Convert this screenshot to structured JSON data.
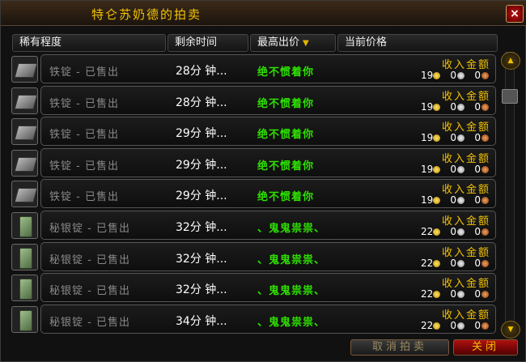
{
  "window": {
    "title": "特仑苏奶德的拍卖",
    "close_icon": "×"
  },
  "columns": [
    {
      "label": "稀有程度"
    },
    {
      "label": "剩余时间"
    },
    {
      "label": "最高出价",
      "sort_icon": "▼"
    },
    {
      "label": "当前价格"
    }
  ],
  "rows": [
    {
      "icon": "iron-ingot-icon",
      "name": "铁锭 - 已售出",
      "time": "28分 钟...",
      "bidder": "绝不惯着你",
      "income_label": "收入金额",
      "gold": "19",
      "silver": "0",
      "copper": "0"
    },
    {
      "icon": "iron-ingot-icon",
      "name": "铁锭 - 已售出",
      "time": "28分 钟...",
      "bidder": "绝不惯着你",
      "income_label": "收入金额",
      "gold": "19",
      "silver": "0",
      "copper": "0"
    },
    {
      "icon": "iron-ingot-icon",
      "name": "铁锭 - 已售出",
      "time": "29分 钟...",
      "bidder": "绝不惯着你",
      "income_label": "收入金额",
      "gold": "19",
      "silver": "0",
      "copper": "0"
    },
    {
      "icon": "iron-ingot-icon",
      "name": "铁锭 - 已售出",
      "time": "29分 钟...",
      "bidder": "绝不惯着你",
      "income_label": "收入金额",
      "gold": "19",
      "silver": "0",
      "copper": "0"
    },
    {
      "icon": "iron-ingot-icon",
      "name": "铁锭 - 已售出",
      "time": "29分 钟...",
      "bidder": "绝不惯着你",
      "income_label": "收入金额",
      "gold": "19",
      "silver": "0",
      "copper": "0"
    },
    {
      "icon": "mithril-ingot-icon",
      "name": "秘银锭 - 已售出",
      "time": "32分 钟...",
      "bidder": "、鬼鬼祟祟、",
      "income_label": "收入金额",
      "gold": "22",
      "silver": "0",
      "copper": "0"
    },
    {
      "icon": "mithril-ingot-icon",
      "name": "秘银锭 - 已售出",
      "time": "32分 钟...",
      "bidder": "、鬼鬼祟祟、",
      "income_label": "收入金额",
      "gold": "22",
      "silver": "0",
      "copper": "0"
    },
    {
      "icon": "mithril-ingot-icon",
      "name": "秘银锭 - 已售出",
      "time": "32分 钟...",
      "bidder": "、鬼鬼祟祟、",
      "income_label": "收入金额",
      "gold": "22",
      "silver": "0",
      "copper": "0"
    },
    {
      "icon": "mithril-ingot-icon",
      "name": "秘银锭 - 已售出",
      "time": "34分 钟...",
      "bidder": "、鬼鬼祟祟、",
      "income_label": "收入金额",
      "gold": "22",
      "silver": "0",
      "copper": "0"
    }
  ],
  "scrollbar": {
    "up_icon": "▲",
    "down_icon": "▼"
  },
  "buttons": {
    "cancel_auction": "取消拍卖",
    "close": "关闭"
  },
  "colors": {
    "title": "#f2c200",
    "bidder": "#2ee000",
    "item_sold": "#888888"
  }
}
